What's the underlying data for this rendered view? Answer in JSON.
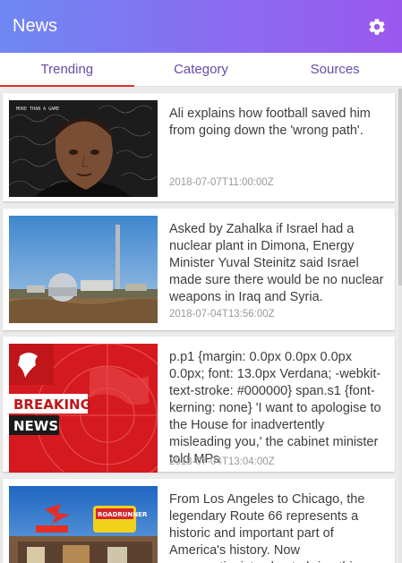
{
  "app": {
    "title": "News",
    "settings_icon": "gear-icon"
  },
  "tabs": [
    {
      "label": "Trending",
      "active": true
    },
    {
      "label": "Category",
      "active": false
    },
    {
      "label": "Sources",
      "active": false
    }
  ],
  "colors": {
    "accent_gradient_start": "#6f87f3",
    "accent_gradient_end": "#9b58ee",
    "tab_text": "#6a4aa8",
    "tab_indicator": "#e5292a"
  },
  "articles": [
    {
      "image": "football-player-photo",
      "image_text": "MORE THAN A GAME",
      "title": "Ali explains how football saved him from going down the 'wrong path'.",
      "date": "2018-07-07T11:00:00Z"
    },
    {
      "image": "nuclear-plant-photo",
      "title": "Asked by Zahalka if Israel had a nuclear plant in Dimona, Energy Minister Yuval Steinitz said Israel made sure there would be no nuclear weapons in Iraq and Syria.",
      "date": "2018-07-04T13:56:00Z"
    },
    {
      "image": "breaking-news-graphic",
      "image_text_1": "BREAKING",
      "image_text_2": "NEWS",
      "title": "p.p1 {margin: 0.0px 0.0px 0.0px 0.0px; font: 13.0px Verdana; -webkit-text-stroke: #000000} span.s1 {font-kerning: none}    'I want to apologise to the House for inadvertently misleading you,' the cabinet minister told MPs",
      "date": "2018-07-04T13:04:00Z"
    },
    {
      "image": "route-66-photo",
      "image_text": "ROADRUNNER",
      "title": "From Los Angeles to Chicago, the legendary Route 66 represents a historic and important part of America's history. Now preservationists plan to bring this",
      "date": ""
    }
  ]
}
